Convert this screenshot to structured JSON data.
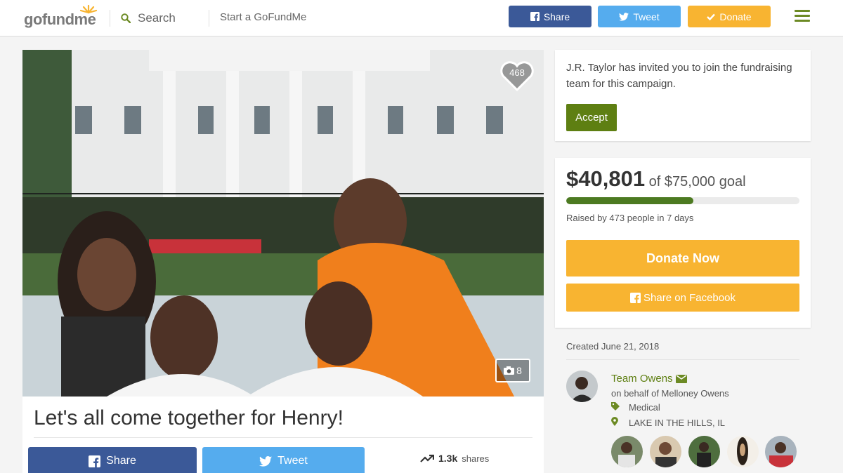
{
  "header": {
    "logo_text": "gofundme",
    "search_label": "Search",
    "start_link": "Start a GoFundMe",
    "share_label": "Share",
    "tweet_label": "Tweet",
    "donate_label": "Donate"
  },
  "campaign": {
    "heart_count": "468",
    "photo_count": "8",
    "title": "Let's all come together for Henry!",
    "share_label": "Share",
    "tweet_label": "Tweet",
    "shares_count": "1.3k",
    "shares_label": "shares"
  },
  "invite": {
    "text": "J.R. Taylor has invited you to join the fundraising team for this campaign.",
    "accept_label": "Accept"
  },
  "funding": {
    "raised": "$40,801",
    "goal_text": "of $75,000 goal",
    "progress_fraction": 0.544,
    "raised_by": "Raised by 473 people in 7 days",
    "donate_now_label": "Donate Now",
    "share_fb_label": "Share on Facebook"
  },
  "organizer": {
    "created": "Created June 21, 2018",
    "name": "Team Owens",
    "behalf": "on behalf of Melloney Owens",
    "category": "Medical",
    "location": "LAKE IN THE HILLS, IL"
  },
  "colors": {
    "brand_green": "#5e7f12",
    "facebook": "#3b5998",
    "twitter": "#55acee",
    "donate_yellow": "#f8b431"
  }
}
